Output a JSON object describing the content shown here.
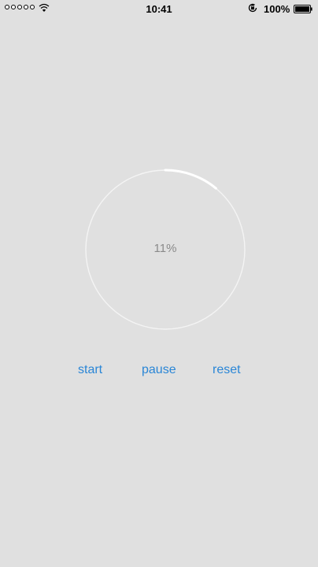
{
  "status_bar": {
    "time": "10:41",
    "battery_percent": "100%",
    "signal_dots": 5,
    "icons": [
      "signal-icon",
      "wifi-icon",
      "rotation-lock-icon",
      "battery-icon"
    ]
  },
  "progress": {
    "value": 0.11,
    "label": "11%",
    "track_color": "#f4f4f4",
    "fill_color": "#ffffff"
  },
  "controls": {
    "start_label": "start",
    "pause_label": "pause",
    "reset_label": "reset",
    "accent_color": "#2a86d6"
  }
}
